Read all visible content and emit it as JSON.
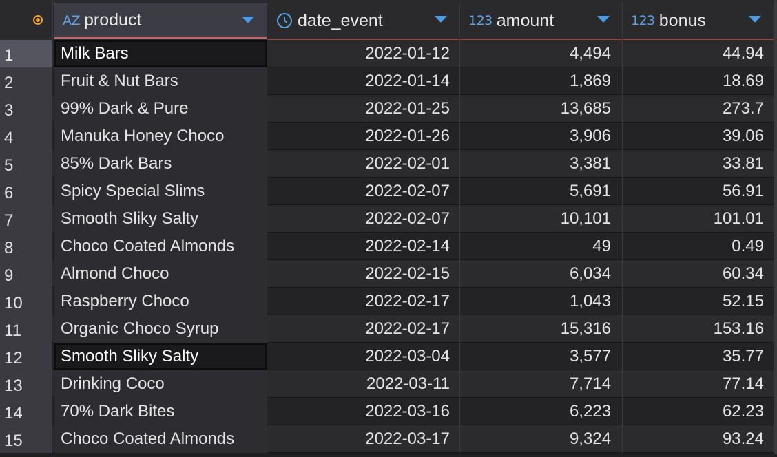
{
  "columns": [
    {
      "key": "product",
      "label": "product",
      "type_icon": "AZ"
    },
    {
      "key": "date",
      "label": "date_event",
      "type_icon": "clock"
    },
    {
      "key": "amount",
      "label": "amount",
      "type_icon": "123"
    },
    {
      "key": "bonus",
      "label": "bonus",
      "type_icon": "123"
    }
  ],
  "rows": [
    {
      "n": "1",
      "product": "Milk Bars",
      "date": "2022-01-12",
      "amount": "4,494",
      "bonus": "44.94"
    },
    {
      "n": "2",
      "product": "Fruit & Nut Bars",
      "date": "2022-01-14",
      "amount": "1,869",
      "bonus": "18.69"
    },
    {
      "n": "3",
      "product": "99% Dark & Pure",
      "date": "2022-01-25",
      "amount": "13,685",
      "bonus": "273.7"
    },
    {
      "n": "4",
      "product": "Manuka Honey Choco",
      "date": "2022-01-26",
      "amount": "3,906",
      "bonus": "39.06"
    },
    {
      "n": "5",
      "product": "85% Dark Bars",
      "date": "2022-02-01",
      "amount": "3,381",
      "bonus": "33.81"
    },
    {
      "n": "6",
      "product": "Spicy Special Slims",
      "date": "2022-02-07",
      "amount": "5,691",
      "bonus": "56.91"
    },
    {
      "n": "7",
      "product": "Smooth Sliky Salty",
      "date": "2022-02-07",
      "amount": "10,101",
      "bonus": "101.01"
    },
    {
      "n": "8",
      "product": "Choco Coated Almonds",
      "date": "2022-02-14",
      "amount": "49",
      "bonus": "0.49"
    },
    {
      "n": "9",
      "product": "Almond Choco",
      "date": "2022-02-15",
      "amount": "6,034",
      "bonus": "60.34"
    },
    {
      "n": "10",
      "product": "Raspberry Choco",
      "date": "2022-02-17",
      "amount": "1,043",
      "bonus": "52.15"
    },
    {
      "n": "11",
      "product": "Organic Choco Syrup",
      "date": "2022-02-17",
      "amount": "15,316",
      "bonus": "153.16"
    },
    {
      "n": "12",
      "product": "Smooth Sliky Salty",
      "date": "2022-03-04",
      "amount": "3,577",
      "bonus": "35.77"
    },
    {
      "n": "13",
      "product": "Drinking Coco",
      "date": "2022-03-11",
      "amount": "7,714",
      "bonus": "77.14"
    },
    {
      "n": "14",
      "product": "70% Dark Bites",
      "date": "2022-03-16",
      "amount": "6,223",
      "bonus": "62.23"
    },
    {
      "n": "15",
      "product": "Choco Coated Almonds",
      "date": "2022-03-17",
      "amount": "9,324",
      "bonus": "93.24"
    }
  ],
  "selected_rows": [
    1,
    12
  ],
  "colors": {
    "accent": "#5aa4e6",
    "sort_arrow": "#4a9be6",
    "corner_marker": "#f0a030",
    "active_header_underline": "#c46565"
  }
}
